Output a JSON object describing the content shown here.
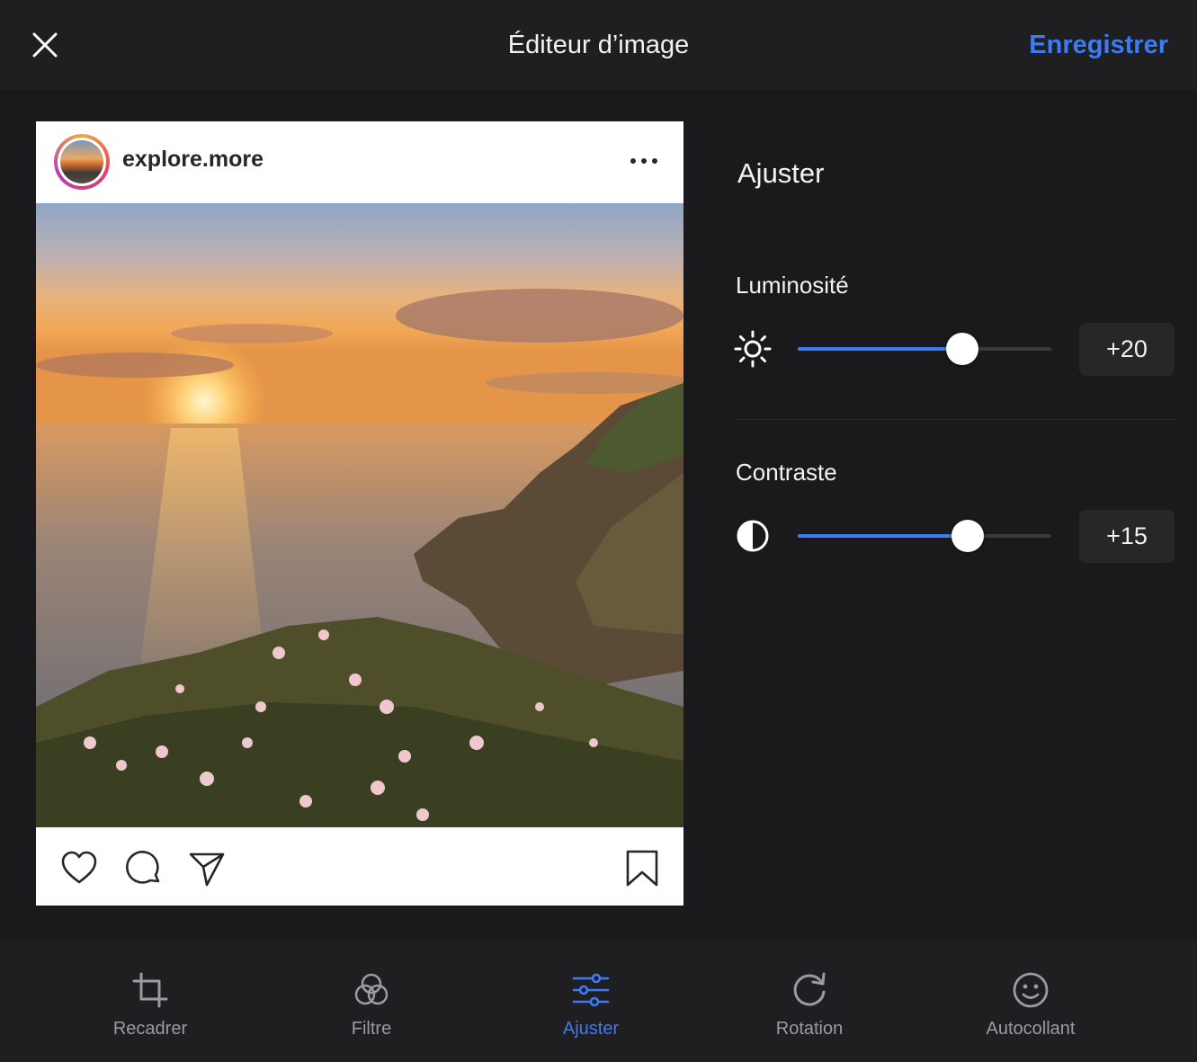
{
  "header": {
    "title": "Éditeur d’image",
    "save_label": "Enregistrer"
  },
  "post": {
    "username": "explore.more"
  },
  "adjust": {
    "title": "Ajuster",
    "brightness": {
      "label": "Luminosité",
      "value_text": "+20",
      "level": 0.65
    },
    "contrast": {
      "label": "Contraste",
      "value_text": "+15",
      "level": 0.67
    }
  },
  "toolbar": {
    "crop": "Recadrer",
    "filter": "Filtre",
    "adjust": "Ajuster",
    "rotation": "Rotation",
    "sticker": "Autocollant"
  },
  "colors": {
    "accent": "#3d7bf5",
    "background": "#1c1c1e"
  }
}
